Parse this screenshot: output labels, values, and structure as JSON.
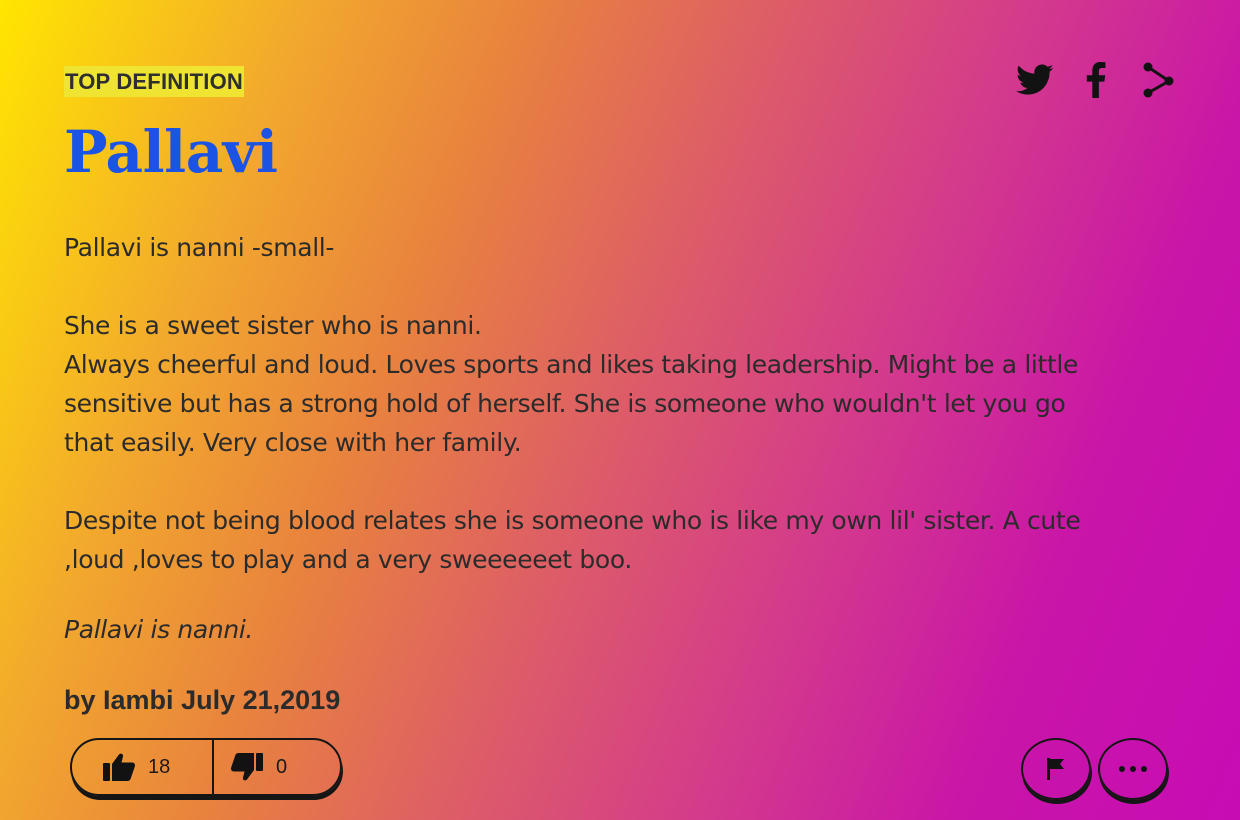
{
  "badge": "TOP DEFINITION",
  "word": "Pallavi",
  "share": {
    "icons": [
      "twitter-icon",
      "facebook-icon",
      "share-icon"
    ]
  },
  "meaning": {
    "lines": [
      "Pallavi is nanni -small-",
      "",
      "She is a sweet sister who is nanni.",
      "Always cheerful and loud. Loves sports and likes taking leadership. Might be a little",
      "sensitive but has a strong hold of herself. She is someone who wouldn't let you go",
      "that easily. Very close with her family.",
      "",
      "Despite not being blood relates she is someone who is like my own lil' sister. A cute",
      ",loud ,loves to play and a very sweeeeeet boo."
    ]
  },
  "example": "Pallavi is nanni.",
  "contributor": {
    "prefix": "by",
    "author": "Iambi",
    "date": "July 21,2019"
  },
  "votes": {
    "up": "18",
    "down": "0"
  },
  "actions": {
    "flag_icon": "flag-icon",
    "more_icon": "more-icon"
  },
  "colors": {
    "word": "#1b54e5",
    "badge_bg": "#efe432",
    "gradient_start": "#ffe600",
    "gradient_end": "#c70cb4"
  }
}
